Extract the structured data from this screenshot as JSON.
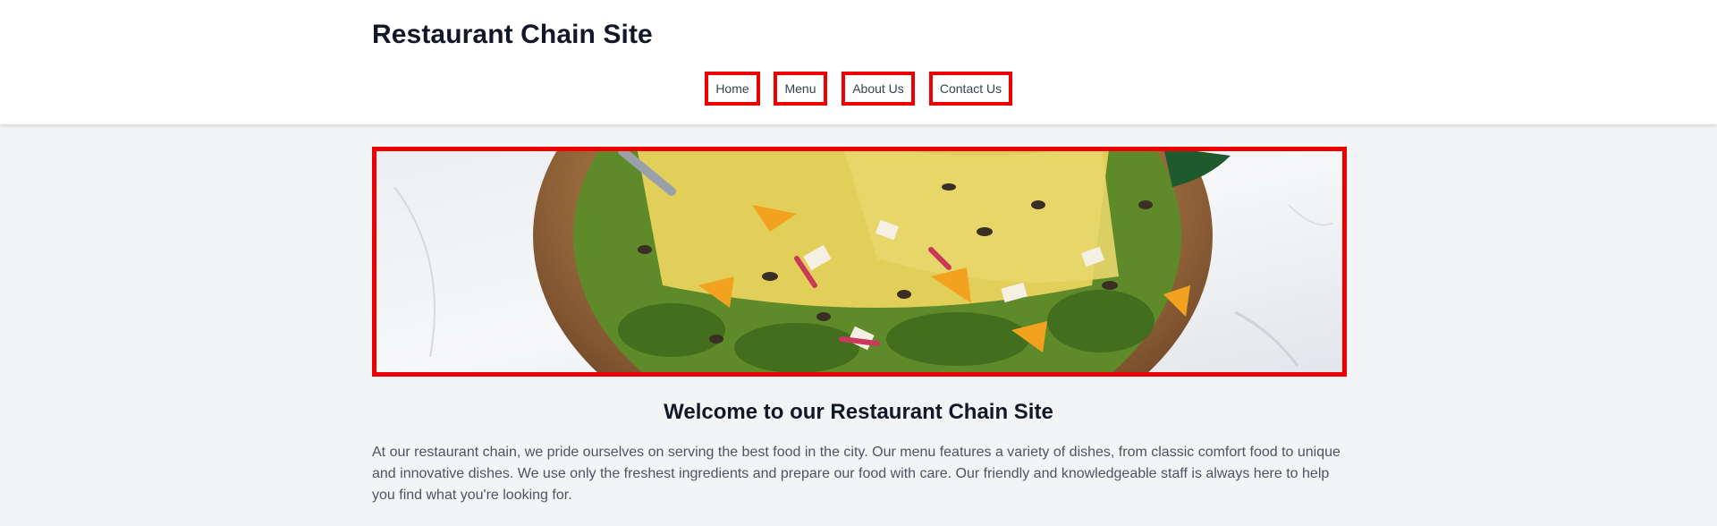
{
  "header": {
    "site_title": "Restaurant Chain Site",
    "nav": [
      {
        "label": "Home"
      },
      {
        "label": "Menu"
      },
      {
        "label": "About Us"
      },
      {
        "label": "Contact Us"
      }
    ]
  },
  "hero": {
    "image": "salad-bowl-photo"
  },
  "main": {
    "heading": "Welcome to our Restaurant Chain Site",
    "intro": "At our restaurant chain, we pride ourselves on serving the best food in the city. Our menu features a variety of dishes, from classic comfort food to unique and innovative dishes. We use only the freshest ingredients and prepare our food with care. Our friendly and knowledgeable staff is always here to help you find what you're looking for."
  },
  "colors": {
    "highlight_border": "#ee0000",
    "page_background": "#f3f4f6",
    "header_background": "#ffffff"
  }
}
